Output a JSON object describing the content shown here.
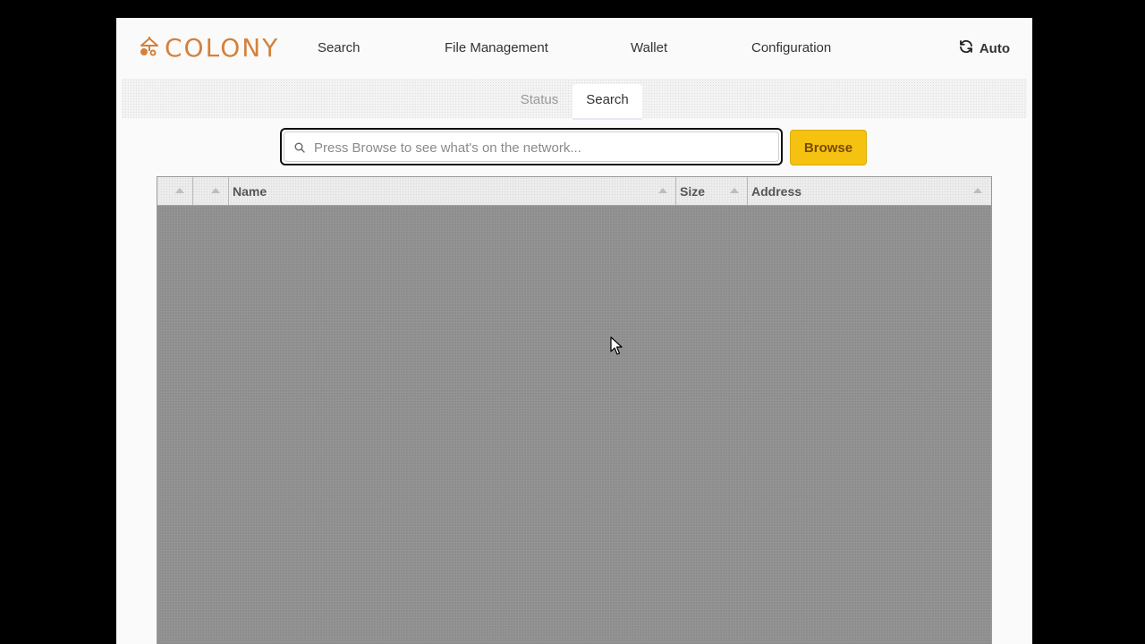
{
  "app": {
    "logo_text": "COLONY"
  },
  "nav": {
    "items": [
      {
        "label": "Search"
      },
      {
        "label": "File Management"
      },
      {
        "label": "Wallet"
      },
      {
        "label": "Configuration"
      }
    ],
    "auto_label": "Auto"
  },
  "subtabs": {
    "items": [
      {
        "label": "Status",
        "active": false
      },
      {
        "label": "Search",
        "active": true
      }
    ]
  },
  "search": {
    "placeholder": "Press Browse to see what's on the network...",
    "value": "",
    "browse_label": "Browse"
  },
  "table": {
    "columns": [
      {
        "label": ""
      },
      {
        "label": ""
      },
      {
        "label": "Name"
      },
      {
        "label": "Size"
      },
      {
        "label": "Address"
      }
    ],
    "rows": []
  },
  "colors": {
    "brand": "#d4813c",
    "browse_button": "#f5c211",
    "table_overlay": "#8f8f8f"
  },
  "icons": {
    "logo": "colony-logo-icon",
    "auto": "refresh-icon",
    "search": "search-icon",
    "sort": "sort-asc-icon",
    "cursor": "mouse-pointer-icon"
  }
}
